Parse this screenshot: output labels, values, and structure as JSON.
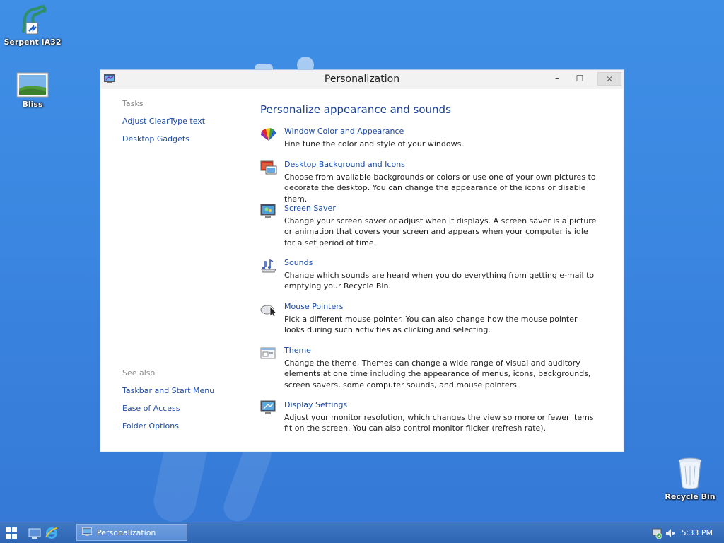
{
  "desktop": {
    "icons": [
      {
        "label": "Serpent IA32"
      },
      {
        "label": "Bliss"
      },
      {
        "label": "Recycle Bin"
      }
    ]
  },
  "window": {
    "title": "Personalization",
    "controls": {
      "minimize": "–",
      "maximize": "☐",
      "close": "✕"
    }
  },
  "left_pane": {
    "tasks_heading": "Tasks",
    "tasks": [
      "Adjust ClearType text",
      "Desktop Gadgets"
    ],
    "see_also_heading": "See also",
    "see_also": [
      "Taskbar and Start Menu",
      "Ease of Access",
      "Folder Options"
    ]
  },
  "main": {
    "title": "Personalize appearance and sounds",
    "items": [
      {
        "label": "Window Color and Appearance",
        "icon": "color-palette-icon",
        "description": "Fine tune the color and style of your windows."
      },
      {
        "label": "Desktop Background and Icons",
        "icon": "desktop-background-icon",
        "description": "Choose from available backgrounds or colors or use one of your own pictures to decorate the desktop. You can change the appearance of the icons or disable them."
      },
      {
        "label": "Screen Saver",
        "icon": "screen-saver-icon",
        "description": "Change your screen saver or adjust when it displays. A screen saver is a picture or animation that covers your screen and appears when your computer is idle for a set period of time."
      },
      {
        "label": "Sounds",
        "icon": "sounds-icon",
        "description": "Change which sounds are heard when you do everything from getting e-mail to emptying your Recycle Bin."
      },
      {
        "label": "Mouse Pointers",
        "icon": "mouse-pointer-icon",
        "description": "Pick a different mouse pointer. You can also change how the mouse pointer looks during such activities as clicking and selecting."
      },
      {
        "label": "Theme",
        "icon": "theme-icon",
        "description": "Change the theme. Themes can change a wide range of visual and auditory elements at one time including the appearance of menus, icons, backgrounds, screen savers, some computer sounds, and mouse pointers."
      },
      {
        "label": "Display Settings",
        "icon": "display-settings-icon",
        "description": "Adjust your monitor resolution, which changes the view so more or fewer items fit on the screen. You can also control monitor flicker (refresh rate)."
      }
    ]
  },
  "taskbar": {
    "window_button": "Personalization",
    "clock": "5:33 PM"
  },
  "colors": {
    "desktop": "#3f8fe6",
    "link": "#1a4aa5",
    "heading": "#1c3f94",
    "taskbar": "#2f66b4"
  }
}
